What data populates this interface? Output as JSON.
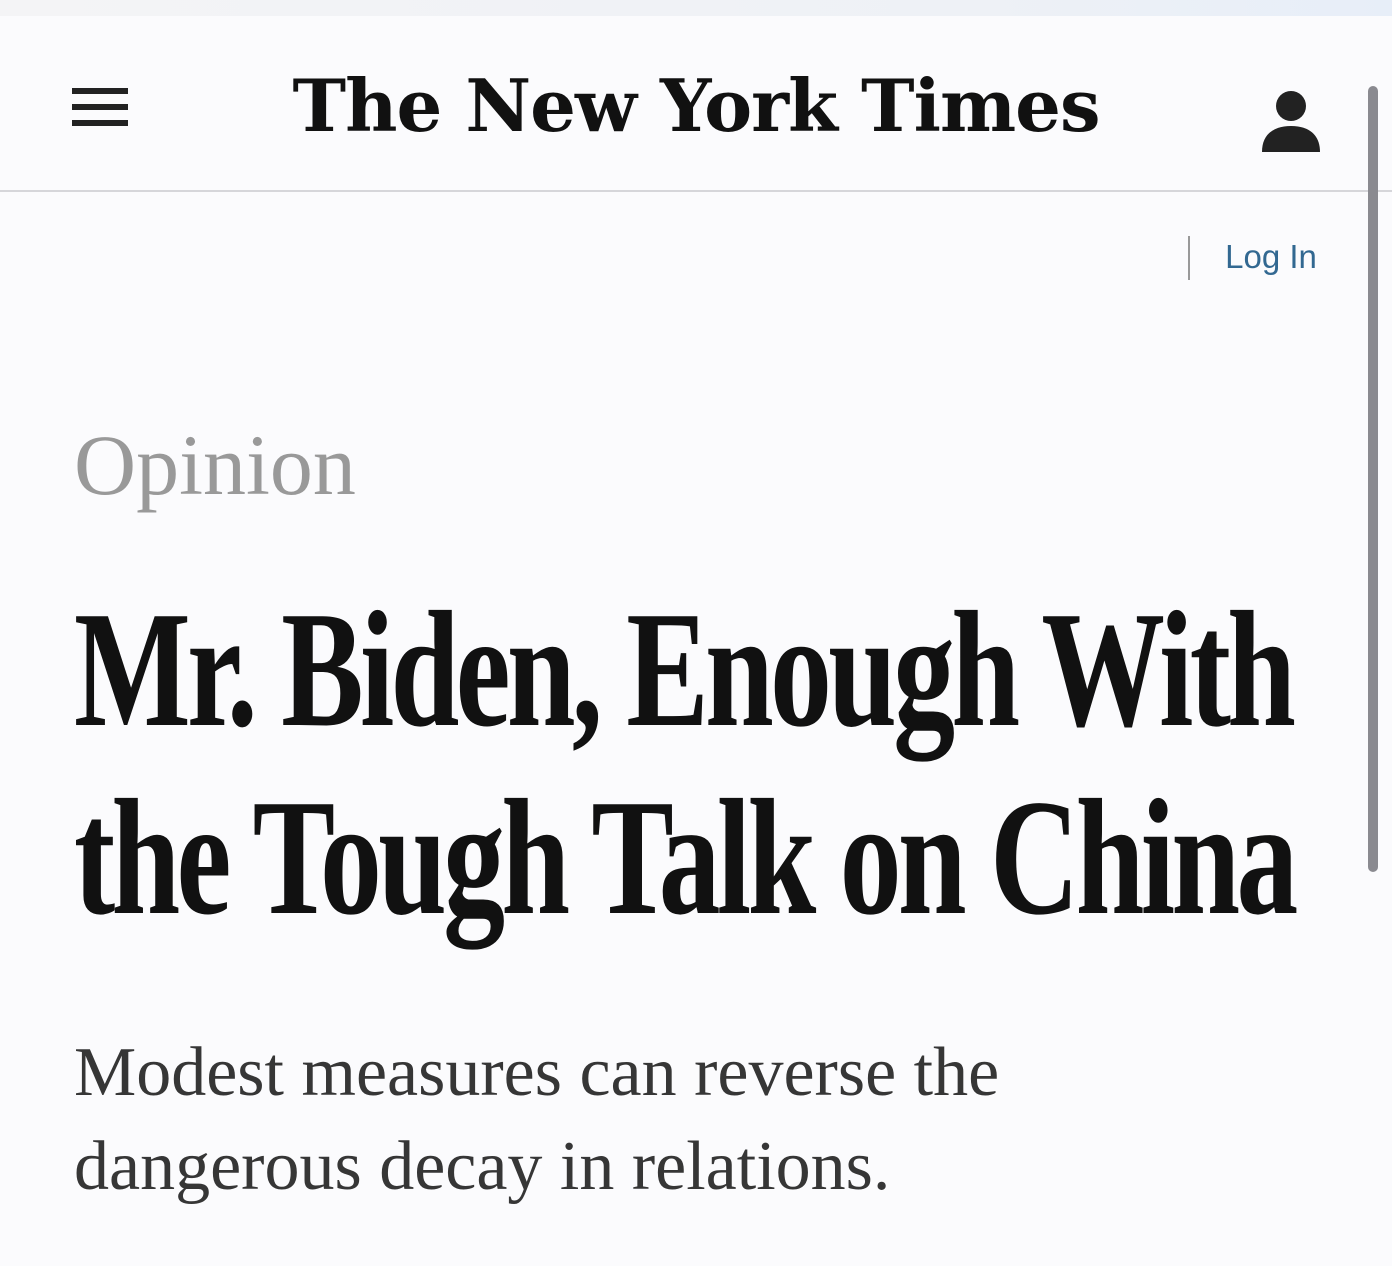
{
  "header": {
    "logo": "The New York Times",
    "menu_icon": "hamburger-menu-icon",
    "account_icon": "user-account-icon"
  },
  "auth": {
    "login_label": "Log In"
  },
  "article": {
    "section": "Opinion",
    "headline_lines": [
      "Mr. Biden, Enough With",
      "the Tough Talk on China"
    ],
    "summary_lines": [
      "Modest measures can reverse the",
      "dangerous decay in relations."
    ]
  },
  "colors": {
    "link": "#326891",
    "section_label": "#999999",
    "text": "#111111",
    "background": "#fbfbfd"
  }
}
